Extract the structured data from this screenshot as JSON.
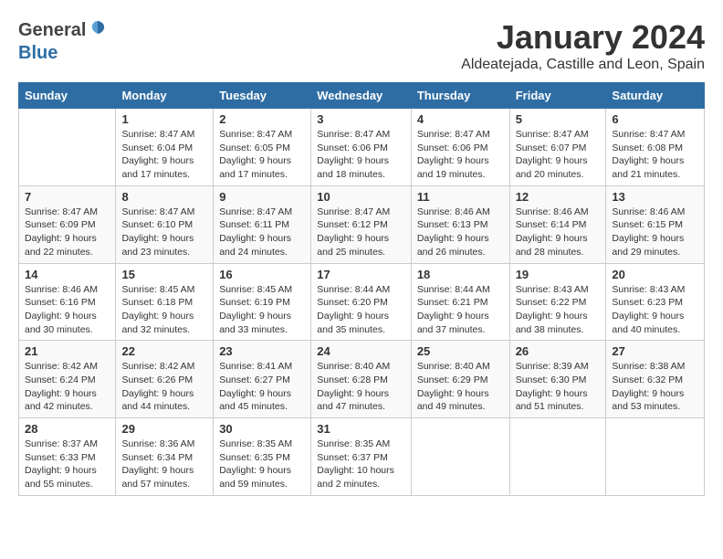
{
  "header": {
    "logo_general": "General",
    "logo_blue": "Blue",
    "month": "January 2024",
    "location": "Aldeatejada, Castille and Leon, Spain"
  },
  "weekdays": [
    "Sunday",
    "Monday",
    "Tuesday",
    "Wednesday",
    "Thursday",
    "Friday",
    "Saturday"
  ],
  "weeks": [
    [
      {
        "day": "",
        "info": ""
      },
      {
        "day": "1",
        "info": "Sunrise: 8:47 AM\nSunset: 6:04 PM\nDaylight: 9 hours\nand 17 minutes."
      },
      {
        "day": "2",
        "info": "Sunrise: 8:47 AM\nSunset: 6:05 PM\nDaylight: 9 hours\nand 17 minutes."
      },
      {
        "day": "3",
        "info": "Sunrise: 8:47 AM\nSunset: 6:06 PM\nDaylight: 9 hours\nand 18 minutes."
      },
      {
        "day": "4",
        "info": "Sunrise: 8:47 AM\nSunset: 6:06 PM\nDaylight: 9 hours\nand 19 minutes."
      },
      {
        "day": "5",
        "info": "Sunrise: 8:47 AM\nSunset: 6:07 PM\nDaylight: 9 hours\nand 20 minutes."
      },
      {
        "day": "6",
        "info": "Sunrise: 8:47 AM\nSunset: 6:08 PM\nDaylight: 9 hours\nand 21 minutes."
      }
    ],
    [
      {
        "day": "7",
        "info": ""
      },
      {
        "day": "8",
        "info": "Sunrise: 8:47 AM\nSunset: 6:10 PM\nDaylight: 9 hours\nand 23 minutes."
      },
      {
        "day": "9",
        "info": "Sunrise: 8:47 AM\nSunset: 6:11 PM\nDaylight: 9 hours\nand 24 minutes."
      },
      {
        "day": "10",
        "info": "Sunrise: 8:47 AM\nSunset: 6:12 PM\nDaylight: 9 hours\nand 25 minutes."
      },
      {
        "day": "11",
        "info": "Sunrise: 8:46 AM\nSunset: 6:13 PM\nDaylight: 9 hours\nand 26 minutes."
      },
      {
        "day": "12",
        "info": "Sunrise: 8:46 AM\nSunset: 6:14 PM\nDaylight: 9 hours\nand 28 minutes."
      },
      {
        "day": "13",
        "info": "Sunrise: 8:46 AM\nSunset: 6:15 PM\nDaylight: 9 hours\nand 29 minutes."
      }
    ],
    [
      {
        "day": "14",
        "info": ""
      },
      {
        "day": "15",
        "info": "Sunrise: 8:45 AM\nSunset: 6:18 PM\nDaylight: 9 hours\nand 32 minutes."
      },
      {
        "day": "16",
        "info": "Sunrise: 8:45 AM\nSunset: 6:19 PM\nDaylight: 9 hours\nand 33 minutes."
      },
      {
        "day": "17",
        "info": "Sunrise: 8:44 AM\nSunset: 6:20 PM\nDaylight: 9 hours\nand 35 minutes."
      },
      {
        "day": "18",
        "info": "Sunrise: 8:44 AM\nSunset: 6:21 PM\nDaylight: 9 hours\nand 37 minutes."
      },
      {
        "day": "19",
        "info": "Sunrise: 8:43 AM\nSunset: 6:22 PM\nDaylight: 9 hours\nand 38 minutes."
      },
      {
        "day": "20",
        "info": "Sunrise: 8:43 AM\nSunset: 6:23 PM\nDaylight: 9 hours\nand 40 minutes."
      }
    ],
    [
      {
        "day": "21",
        "info": ""
      },
      {
        "day": "22",
        "info": "Sunrise: 8:42 AM\nSunset: 6:26 PM\nDaylight: 9 hours\nand 44 minutes."
      },
      {
        "day": "23",
        "info": "Sunrise: 8:41 AM\nSunset: 6:27 PM\nDaylight: 9 hours\nand 45 minutes."
      },
      {
        "day": "24",
        "info": "Sunrise: 8:40 AM\nSunset: 6:28 PM\nDaylight: 9 hours\nand 47 minutes."
      },
      {
        "day": "25",
        "info": "Sunrise: 8:40 AM\nSunset: 6:29 PM\nDaylight: 9 hours\nand 49 minutes."
      },
      {
        "day": "26",
        "info": "Sunrise: 8:39 AM\nSunset: 6:30 PM\nDaylight: 9 hours\nand 51 minutes."
      },
      {
        "day": "27",
        "info": "Sunrise: 8:38 AM\nSunset: 6:32 PM\nDaylight: 9 hours\nand 53 minutes."
      }
    ],
    [
      {
        "day": "28",
        "info": ""
      },
      {
        "day": "29",
        "info": "Sunrise: 8:36 AM\nSunset: 6:34 PM\nDaylight: 9 hours\nand 57 minutes."
      },
      {
        "day": "30",
        "info": "Sunrise: 8:35 AM\nSunset: 6:35 PM\nDaylight: 9 hours\nand 59 minutes."
      },
      {
        "day": "31",
        "info": "Sunrise: 8:35 AM\nSunset: 6:37 PM\nDaylight: 10 hours\nand 2 minutes."
      },
      {
        "day": "",
        "info": ""
      },
      {
        "day": "",
        "info": ""
      },
      {
        "day": "",
        "info": ""
      }
    ]
  ],
  "week1_sunday": "Sunrise: 8:47 AM\nSunset: 6:09 PM\nDaylight: 9 hours\nand 22 minutes.",
  "week2_sunday": "Sunrise: 8:46 AM\nSunset: 6:16 PM\nDaylight: 9 hours\nand 30 minutes.",
  "week3_sunday": "Sunrise: 8:46 AM\nSunset: 6:16 PM\nDaylight: 9 hours\nand 30 minutes.",
  "week4_sunday": "Sunrise: 8:42 AM\nSunset: 6:24 PM\nDaylight: 9 hours\nand 42 minutes.",
  "week5_sunday": "Sunrise: 8:37 AM\nSunset: 6:33 PM\nDaylight: 9 hours\nand 55 minutes."
}
